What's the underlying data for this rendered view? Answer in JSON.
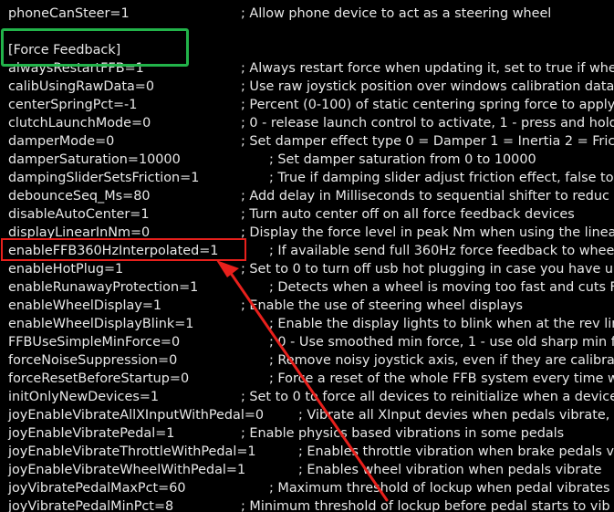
{
  "editor": {
    "lines": [
      {
        "key": "phoneCanSteer=1",
        "comment": "; Allow phone device to act as a steering wheel"
      },
      {
        "key": "",
        "comment": ""
      },
      {
        "key": "[Force Feedback]",
        "comment": ""
      },
      {
        "key": "alwaysRestartFFB=1",
        "comment": "; Always restart force when updating it, set to true if whe"
      },
      {
        "key": "calibUsingRawData=0",
        "comment": "; Use raw joystick position over windows calibration data"
      },
      {
        "key": "centerSpringPct=-1",
        "comment": "; Percent (0-100) of static centering spring force to apply"
      },
      {
        "key": "clutchLaunchMode=0",
        "comment": "; 0 - release launch control to activate, 1 - press and hold"
      },
      {
        "key": "damperMode=0",
        "comment": "; Set damper effect type 0 = Damper 1 = Inertia 2 = Frict"
      },
      {
        "key": "damperSaturation=10000",
        "comment": "; Set damper saturation from 0 to 10000"
      },
      {
        "key": "dampingSliderSetsFriction=1",
        "comment": "; True if damping slider adjust friction effect, false to"
      },
      {
        "key": "debounceSeq_Ms=80",
        "comment": "; Add delay in Milliseconds to sequential shifter to reduc"
      },
      {
        "key": "disableAutoCenter=1",
        "comment": "; Turn auto center off on all force feedback devices"
      },
      {
        "key": "displayLinearInNm=0",
        "comment": "; Display the force level in peak Nm when using the linear"
      },
      {
        "key": "enableFFB360HzInterpolated=1",
        "comment": "; If available send full 360Hz force feedback to whee"
      },
      {
        "key": "enableHotPlug=1",
        "comment": "; Set to 0 to turn off usb hot plugging in case you have u"
      },
      {
        "key": "enableRunawayProtection=1",
        "comment": "; Detects when a wheel is moving too fast and cuts F"
      },
      {
        "key": "enableWheelDisplay=1",
        "comment": "; Enable the use of steering wheel displays"
      },
      {
        "key": "enableWheelDisplayBlink=1",
        "comment": "; Enable the display lights to blink when at the rev lin"
      },
      {
        "key": "FFBUseSimpleMinForce=0",
        "comment": "; 0 - Use smoothed min force, 1 - use old sharp min f"
      },
      {
        "key": "forceNoiseSuppression=0",
        "comment": "; Remove noisy joystick axis, even if they are calibrat"
      },
      {
        "key": "forceResetBeforeStartup=0",
        "comment": "; Force a reset of the whole FFB system every time w"
      },
      {
        "key": "initOnlyNewDevices=1",
        "comment": "; Set to 0 to force all devices to reinitialize when a device"
      },
      {
        "key": "joyEnableVibrateAllXInputWithPedal=0",
        "comment": "; Vibrate all XInput devies when pedals vibrate, c"
      },
      {
        "key": "joyEnableVibratePedal=1",
        "comment": "; Enable physics based vibrations in some pedals"
      },
      {
        "key": "joyEnableVibrateThrottleWithPedal=1",
        "comment": "; Enables throttle vibration when brake pedals v"
      },
      {
        "key": "joyEnableVibrateWheelWithPedal=1",
        "comment": "; Enables wheel vibration when pedals vibrate"
      },
      {
        "key": "joyVibratePedalMaxPct=60",
        "comment": "; Maximum threshold of lockup when pedal vibrates"
      },
      {
        "key": "joyVibratePedalMinPct=8",
        "comment": "; Minimum threshold of lockup before pedal starts to vib"
      }
    ]
  },
  "annotations": {
    "green_box_color": "#22b34a",
    "red_box_color": "#e8201c",
    "arrow_color": "#e8201c"
  }
}
